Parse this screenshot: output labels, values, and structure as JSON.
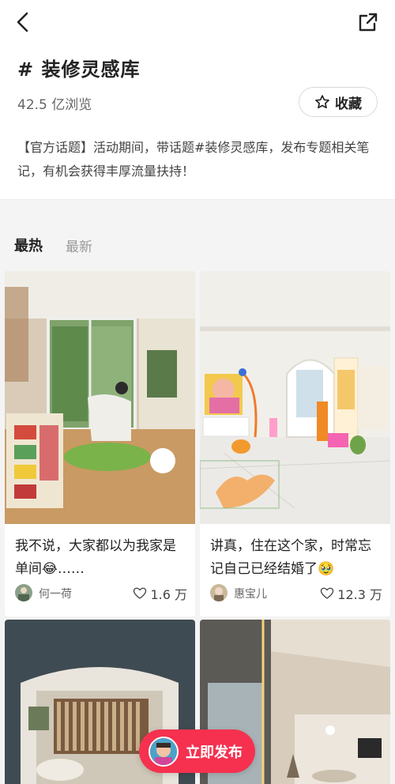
{
  "topic": {
    "title": "# 装修灵感库",
    "views": "42.5 亿浏览",
    "favorite_label": "收藏",
    "description": "【官方话题】活动期间，带话题#装修灵感库，发布专题相关笔记，有机会获得丰厚流量扶持！"
  },
  "tabs": [
    {
      "label": "最热",
      "active": true
    },
    {
      "label": "最新",
      "active": false
    }
  ],
  "posts": [
    {
      "title": "我不说，大家都以为我家是单间😂……",
      "author": "何一荷",
      "likes": "1.6 万"
    },
    {
      "title": "讲真，住在这个家，时常忘记自己已经结婚了🥹",
      "author": "惠宝儿",
      "likes": "12.3 万"
    }
  ],
  "publish": {
    "label": "立即发布"
  },
  "colors": {
    "accent": "#f5314f",
    "background": "#f4f4f4"
  }
}
